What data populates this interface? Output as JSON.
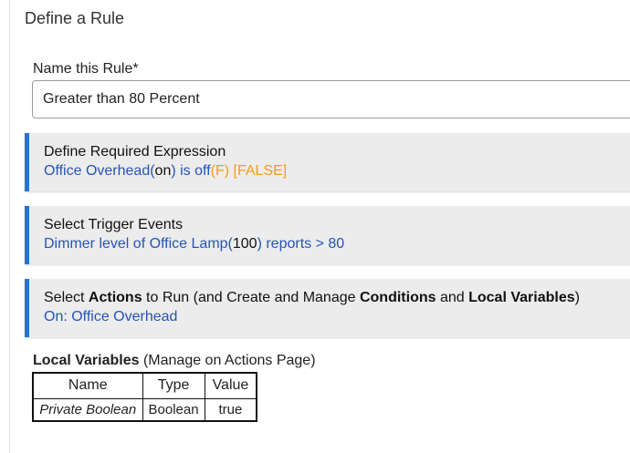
{
  "page": {
    "title": "Define a Rule"
  },
  "rule_name": {
    "label": "Name this Rule*",
    "value": "Greater than 80 Percent"
  },
  "sections": {
    "expression": {
      "title": "Define Required Expression",
      "device": "Office Overhead",
      "paren_open": "(",
      "state": "on",
      "paren_close": ")",
      "condition": " is off",
      "flag": "(F) [FALSE]"
    },
    "triggers": {
      "title": "Select Trigger Events",
      "prefix": "Dimmer level of Office Lamp",
      "paren_open": "(",
      "value": "100",
      "paren_close": ")",
      "suffix": " reports > 80"
    },
    "actions": {
      "t1": "Select ",
      "t2": "Actions",
      "t3": " to Run (and Create and Manage ",
      "t4": "Conditions",
      "t5": " and ",
      "t6": "Local Variables",
      "t7": ")",
      "subtitle": "On: Office Overhead"
    }
  },
  "local_variables": {
    "heading": "Local Variables",
    "heading_note": " (Manage on Actions Page)",
    "columns": [
      "Name",
      "Type",
      "Value"
    ],
    "rows": [
      {
        "name": "Private Boolean",
        "type": "Boolean",
        "value": "true"
      }
    ]
  },
  "colors": {
    "accent": "#1e76d8",
    "link": "#2554b7",
    "false_flag": "#f29c14",
    "section_bg": "#ececec"
  }
}
